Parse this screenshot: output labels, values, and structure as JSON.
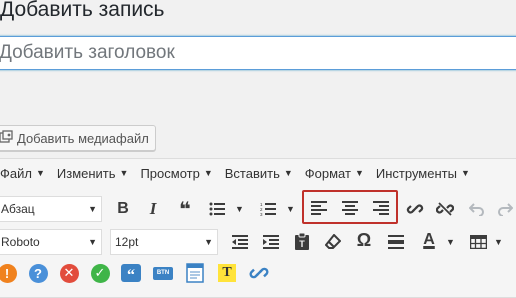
{
  "page": {
    "title": "Добавить запись"
  },
  "title_field": {
    "placeholder": "Добавить заголовок",
    "value": ""
  },
  "media": {
    "label": "Добавить медиафайл"
  },
  "menubar": [
    {
      "label": "Файл"
    },
    {
      "label": "Изменить"
    },
    {
      "label": "Просмотр"
    },
    {
      "label": "Вставить"
    },
    {
      "label": "Формат"
    },
    {
      "label": "Инструменты"
    }
  ],
  "toolbar1": {
    "format_select": "Абзац",
    "buttons": [
      "bold-icon",
      "italic-icon",
      "blockquote-icon",
      "bullet-list-icon",
      "numbered-list-icon",
      "align-left-icon",
      "align-center-icon",
      "align-right-icon",
      "link-icon",
      "unlink-icon",
      "undo-icon",
      "redo-icon"
    ],
    "bold": "B",
    "italic": "I",
    "quote": "❝"
  },
  "toolbar2": {
    "font_select": "Roboto",
    "size_select": "12pt",
    "special_char": "Ω",
    "text_color": "A"
  },
  "toolbar3": {
    "icons": [
      "warning-icon",
      "help-icon",
      "error-icon",
      "success-icon",
      "quotes-icon",
      "button-icon",
      "note-icon",
      "highlight-icon",
      "shortcode-link-icon"
    ],
    "button_label": "BTN",
    "highlight_label": "T"
  },
  "colors": {
    "focus_border": "#5b9dd9",
    "highlight_box": "#c0312b",
    "warning": "#f0821e",
    "help": "#4a90d9",
    "error": "#e24c3c",
    "success": "#3fb548"
  }
}
